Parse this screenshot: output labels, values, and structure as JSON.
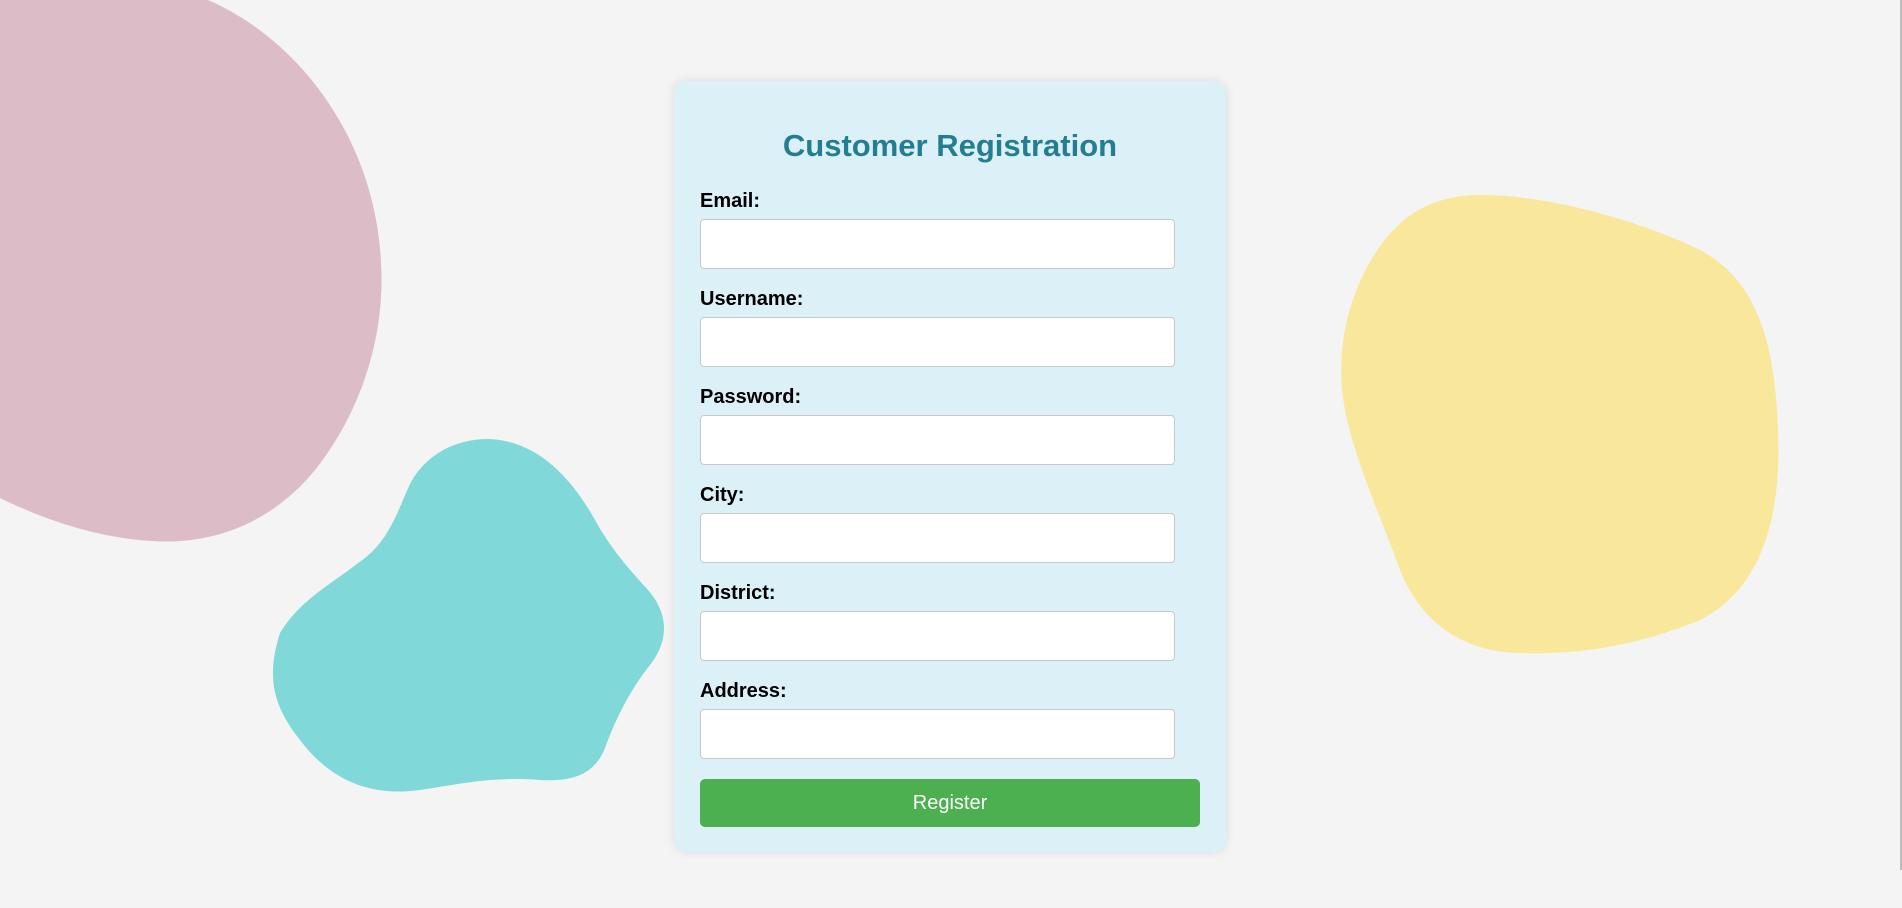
{
  "form": {
    "title": "Customer Registration",
    "fields": [
      {
        "label": "Email:",
        "value": "",
        "placeholder": ""
      },
      {
        "label": "Username:",
        "value": "",
        "placeholder": ""
      },
      {
        "label": "Password:",
        "value": "",
        "placeholder": ""
      },
      {
        "label": "City:",
        "value": "",
        "placeholder": ""
      },
      {
        "label": "District:",
        "value": "",
        "placeholder": ""
      },
      {
        "label": "Address:",
        "value": "",
        "placeholder": ""
      }
    ],
    "submit_label": "Register"
  },
  "colors": {
    "page_background": "#f4f4f4",
    "card_background": "#dcf0f8",
    "title": "#247e91",
    "button": "#4caf50",
    "blob_pink": "#dbbcc7",
    "blob_teal": "#80d9d8",
    "blob_yellow": "#f9e89c"
  }
}
